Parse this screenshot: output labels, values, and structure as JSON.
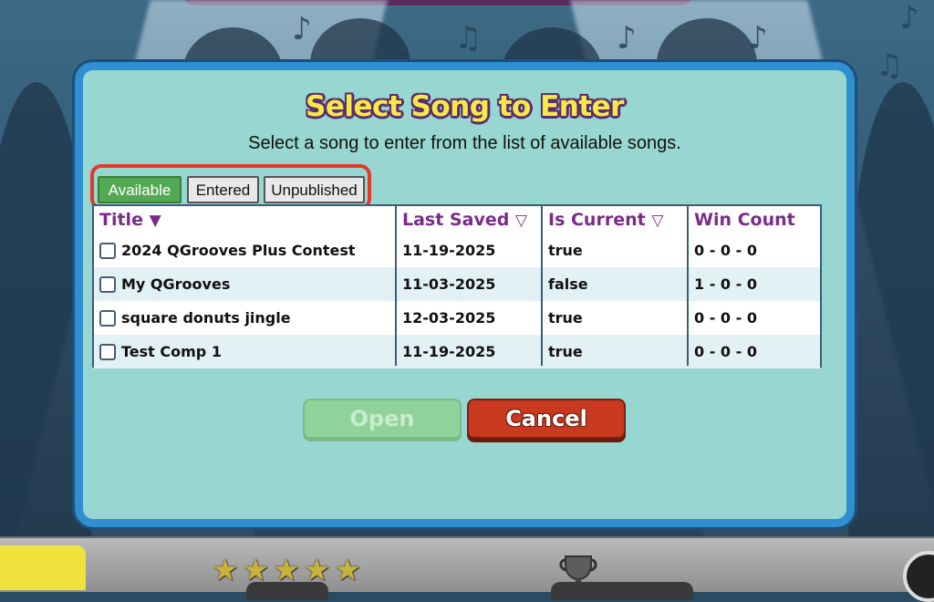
{
  "dialog": {
    "title": "Select Song to Enter",
    "subtitle": "Select a song to enter from the list of available songs."
  },
  "tabs": [
    {
      "label": "Available",
      "active": true
    },
    {
      "label": "Entered",
      "active": false
    },
    {
      "label": "Unpublished",
      "active": false
    }
  ],
  "table": {
    "columns": [
      {
        "label": "Title",
        "sort": "▼"
      },
      {
        "label": "Last Saved",
        "sort": "▽"
      },
      {
        "label": "Is Current",
        "sort": "▽"
      },
      {
        "label": "Win Count",
        "sort": ""
      }
    ],
    "rows": [
      {
        "title": "2024 QGrooves Plus Contest",
        "last_saved": "11-19-2025",
        "is_current": "true",
        "win_count": "0 - 0 - 0"
      },
      {
        "title": "My QGrooves",
        "last_saved": "11-03-2025",
        "is_current": "false",
        "win_count": "1 - 0 - 0"
      },
      {
        "title": "square donuts jingle",
        "last_saved": "12-03-2025",
        "is_current": "true",
        "win_count": "0 - 0 - 0"
      },
      {
        "title": "Test Comp 1",
        "last_saved": "11-19-2025",
        "is_current": "true",
        "win_count": "0 - 0 - 0"
      }
    ]
  },
  "buttons": {
    "open_label": "Open",
    "cancel_label": "Cancel"
  },
  "colors": {
    "dialog_bg": "#98d7d1",
    "dialog_border": "#2f8fd0",
    "title_yellow": "#f7e84a",
    "header_purple": "#7b2a8a",
    "tab_active": "#53a853",
    "highlight_red": "#e23a2a",
    "cancel_red": "#c9391f",
    "open_green_disabled": "#8fd39a"
  }
}
